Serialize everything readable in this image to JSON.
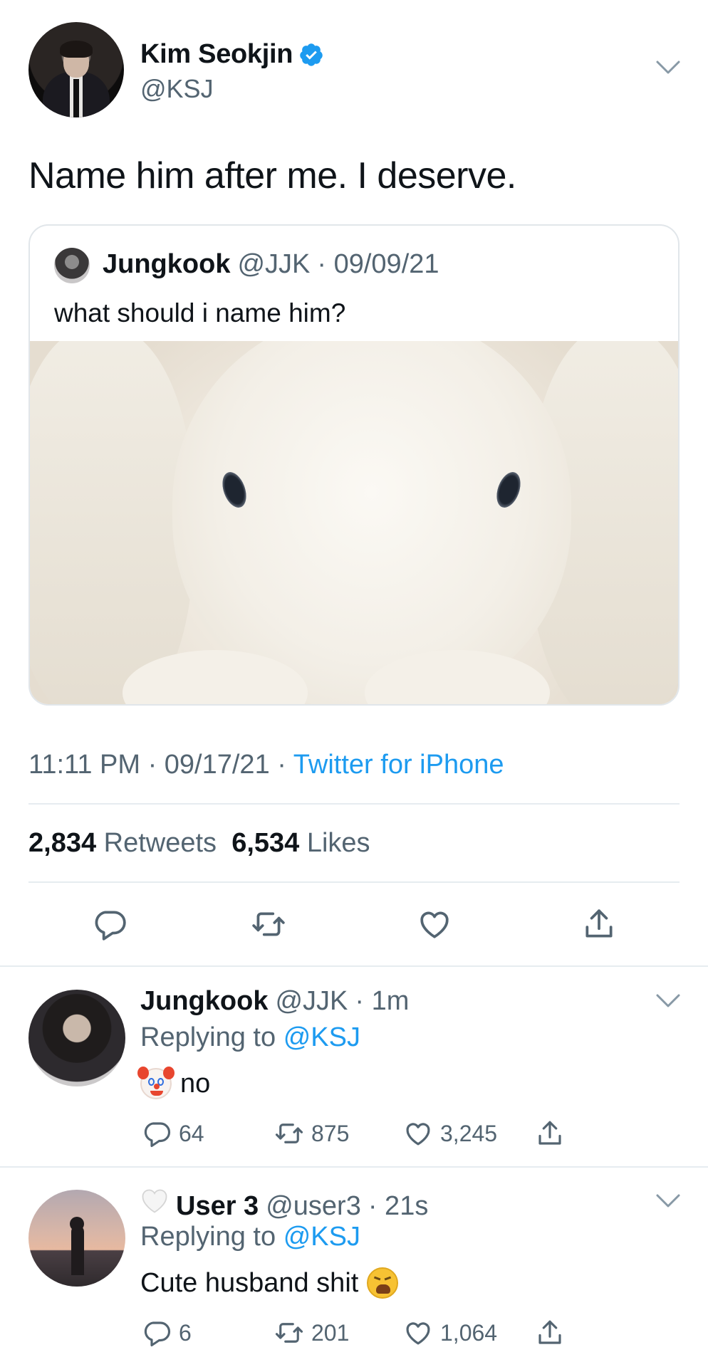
{
  "main_tweet": {
    "name": "Kim Seokjin",
    "handle": "@KSJ",
    "text": "Name him after me. I deserve.",
    "time": "11:11 PM · 09/17/21 ·",
    "source": "Twitter for iPhone",
    "retweets_count": "2,834",
    "retweets_label": "Retweets",
    "likes_count": "6,534",
    "likes_label": "Likes"
  },
  "quote": {
    "name": "Jungkook",
    "handle": "@JJK",
    "date": "· 09/09/21",
    "text": "what should i name him?"
  },
  "replies": [
    {
      "name": "Jungkook",
      "handle": "@JJK",
      "time": "· 1m",
      "replying_label": "Replying to",
      "replying_to": "@KSJ",
      "text": "no",
      "emoji": "clown-face",
      "reply_count": "64",
      "retweet_count": "875",
      "like_count": "3,245"
    },
    {
      "name": "User 3",
      "handle": "@user3",
      "time": "· 21s",
      "replying_label": "Replying to",
      "replying_to": "@KSJ",
      "text": "Cute husband shit",
      "emoji": "weary-face",
      "name_prefix_emoji": "white-heart",
      "reply_count": "6",
      "retweet_count": "201",
      "like_count": "1,064"
    }
  ],
  "colors": {
    "accent": "#1d9bf0",
    "secondary_text": "#536471",
    "primary_text": "#0f1419",
    "divider": "#e6ecf0"
  }
}
